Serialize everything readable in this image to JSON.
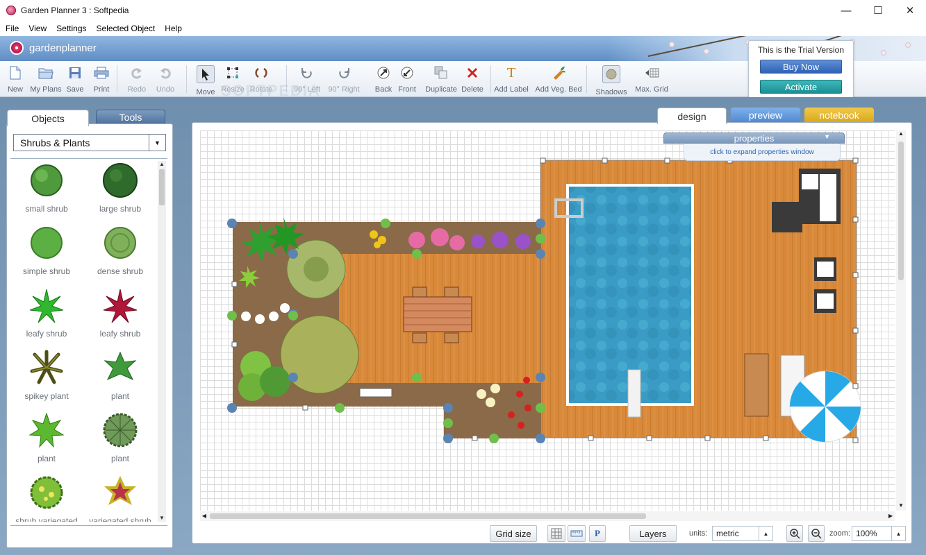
{
  "window": {
    "title": "Garden Planner 3 : Softpedia",
    "minimize": "—",
    "maximize": "☐",
    "close": "✕"
  },
  "menu": [
    "File",
    "View",
    "Settings",
    "Selected Object",
    "Help"
  ],
  "brand": {
    "logo_text": "gardenplanner"
  },
  "toolbar": {
    "new": "New",
    "my_plans": "My Plans",
    "save": "Save",
    "print": "Print",
    "redo": "Redo",
    "undo": "Undo",
    "move": "Move",
    "resize": "Resize",
    "rotate": "Rotate",
    "rot_left": "90° Left",
    "rot_right": "90° Right",
    "back": "Back",
    "front": "Front",
    "duplicate": "Duplicate",
    "delete": "Delete",
    "add_label": "Add Label",
    "add_veg_bed": "Add Veg. Bed",
    "shadows": "Shadows",
    "max_grid": "Max. Grid"
  },
  "trial": {
    "text": "This is the Trial Version",
    "buy": "Buy Now",
    "activate": "Activate"
  },
  "left_tabs": {
    "objects": "Objects",
    "tools": "Tools"
  },
  "category": {
    "selected": "Shrubs & Plants",
    "arrow": "▼"
  },
  "objects": [
    {
      "name": "small shrub",
      "icon": "small-shrub-icon",
      "color": "#4f9a3c"
    },
    {
      "name": "large shrub",
      "icon": "large-shrub-icon",
      "color": "#2f6b2a"
    },
    {
      "name": "simple shrub",
      "icon": "simple-shrub-icon",
      "color": "#5cb043"
    },
    {
      "name": "dense shrub",
      "icon": "dense-shrub-icon",
      "color": "#7fb05a"
    },
    {
      "name": "leafy shrub",
      "icon": "leafy-shrub-green-icon",
      "color": "#2fb82f"
    },
    {
      "name": "leafy shrub",
      "icon": "leafy-shrub-red-icon",
      "color": "#b0173a"
    },
    {
      "name": "spikey plant",
      "icon": "spikey-plant-icon",
      "color": "#6b6a22"
    },
    {
      "name": "plant",
      "icon": "plant-star-icon",
      "color": "#3e9a3a"
    },
    {
      "name": "plant",
      "icon": "plant-leaf-icon",
      "color": "#5cb82f"
    },
    {
      "name": "plant",
      "icon": "plant-dark-icon",
      "color": "#4a7d3a"
    },
    {
      "name": "shrub variegated",
      "icon": "shrub-variegated-icon",
      "color": "#7fbf3a"
    },
    {
      "name": "variegated shrub",
      "icon": "variegated-shrub-icon",
      "color": "#b8324a"
    }
  ],
  "design_tabs": {
    "design": "design",
    "preview": "preview",
    "notebook": "notebook"
  },
  "properties": {
    "title": "properties",
    "hint": "click to expand properties window",
    "chevron": "▼"
  },
  "bottom": {
    "grid_size": "Grid size",
    "layers": "Layers",
    "units_label": "units:",
    "units_value": "metric",
    "zoom_label": "zoom:",
    "zoom_value": "100%",
    "p_button": "P"
  },
  "watermark": "SOFTPEDIA"
}
